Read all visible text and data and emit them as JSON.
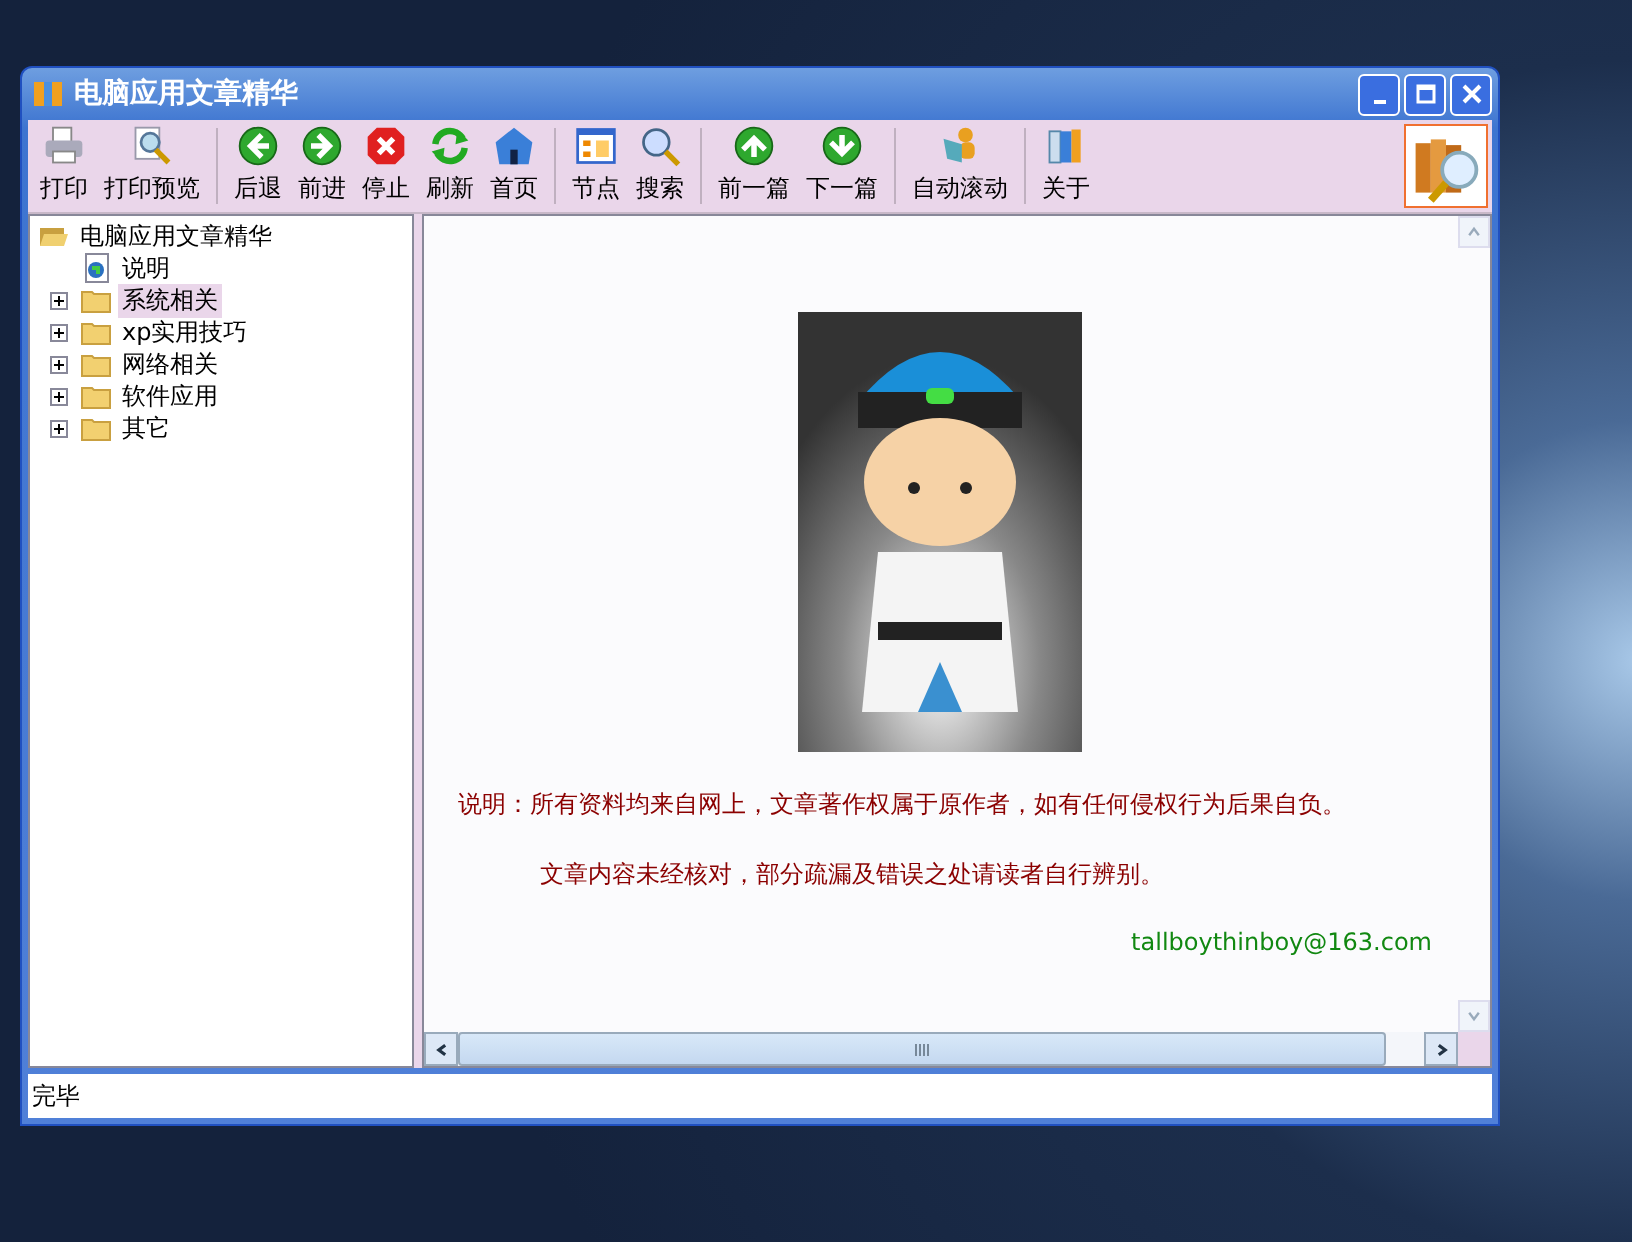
{
  "window": {
    "title": "电脑应用文章精华"
  },
  "toolbar": [
    [
      {
        "kind": "print",
        "label": "打印"
      },
      {
        "kind": "preview",
        "label": "打印预览"
      }
    ],
    [
      {
        "kind": "back",
        "label": "后退"
      },
      {
        "kind": "forward",
        "label": "前进"
      },
      {
        "kind": "stop",
        "label": "停止"
      },
      {
        "kind": "refresh",
        "label": "刷新"
      },
      {
        "kind": "home",
        "label": "首页"
      }
    ],
    [
      {
        "kind": "nodes",
        "label": "节点"
      },
      {
        "kind": "search",
        "label": "搜索"
      }
    ],
    [
      {
        "kind": "up",
        "label": "前一篇"
      },
      {
        "kind": "down",
        "label": "下一篇"
      }
    ],
    [
      {
        "kind": "reader",
        "label": "自动滚动"
      }
    ],
    [
      {
        "kind": "book",
        "label": "关于"
      }
    ]
  ],
  "tree": {
    "label": "电脑应用文章精华",
    "children": [
      {
        "kind": "document",
        "label": "说明",
        "selected": false
      },
      {
        "kind": "folder",
        "label": "系统相关",
        "selected": true,
        "expanded": false
      },
      {
        "kind": "folder",
        "label": "xp实用技巧",
        "selected": false,
        "expanded": false
      },
      {
        "kind": "folder",
        "label": "网络相关",
        "selected": false,
        "expanded": false
      },
      {
        "kind": "folder",
        "label": "软件应用",
        "selected": false,
        "expanded": false
      },
      {
        "kind": "folder",
        "label": "其它",
        "selected": false,
        "expanded": false
      }
    ]
  },
  "content": {
    "notice": "说明：所有资料均来自网上，文章著作权属于原作者，如有任何侵权行为后果自负。",
    "disclaimer": "文章内容未经核对，部分疏漏及错误之处请读者自行辨别。",
    "email": "tallboythinboy@163.com"
  },
  "status_bar": "完毕"
}
